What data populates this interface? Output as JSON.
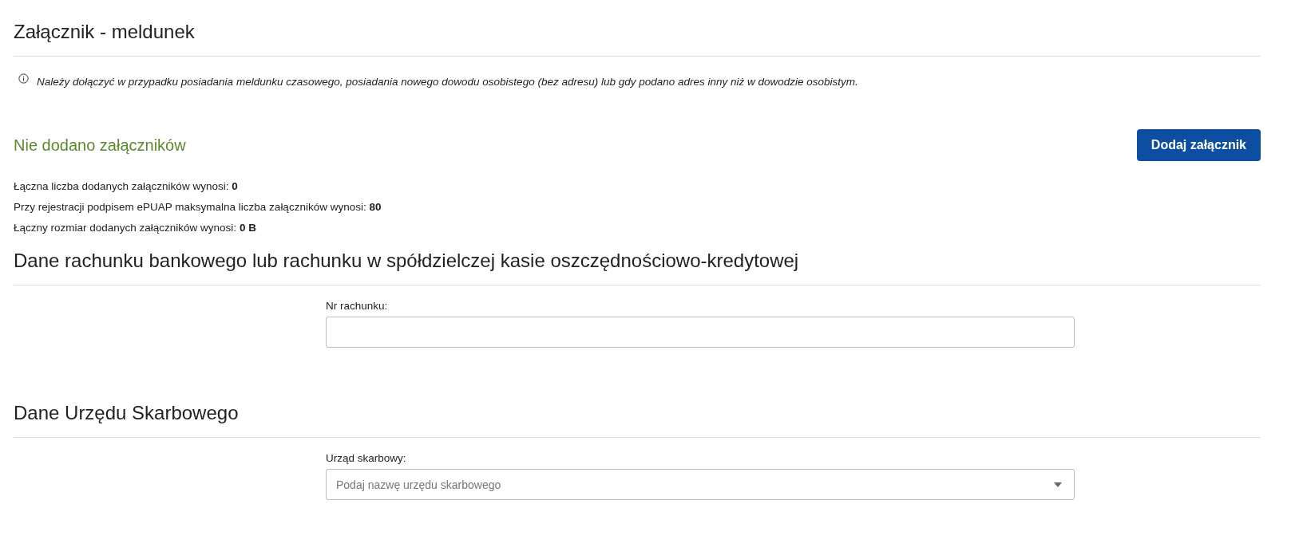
{
  "attachment_section": {
    "title": "Załącznik - meldunek",
    "info": "Należy dołączyć w przypadku posiadania meldunku czasowego, posiadania nowego dowodu osobistego (bez adresu) lub gdy podano adres inny niż w dowodzie osobistym.",
    "status": "Nie dodano załączników",
    "add_button": "Dodaj załącznik",
    "stats": [
      "Łączna liczba dodanych załączników wynosi: **0**",
      "Przy rejestracji podpisem ePUAP maksymalna liczba załączników wynosi: **80**",
      "Łączny rozmiar dodanych załączników wynosi: **0 B**"
    ]
  },
  "sections": [
    {
      "title": "Dane rachunku bankowego lub rachunku w spółdzielczej kasie oszczędnościowo-kredytowej",
      "field": {
        "kind": "text",
        "label": "Nr rachunku:"
      }
    },
    {
      "title": "Dane Urzędu Skarbowego",
      "field": {
        "kind": "select",
        "label": "Urząd skarbowy:",
        "placeholder": "Podaj nazwę urzędu skarbowego"
      }
    }
  ]
}
